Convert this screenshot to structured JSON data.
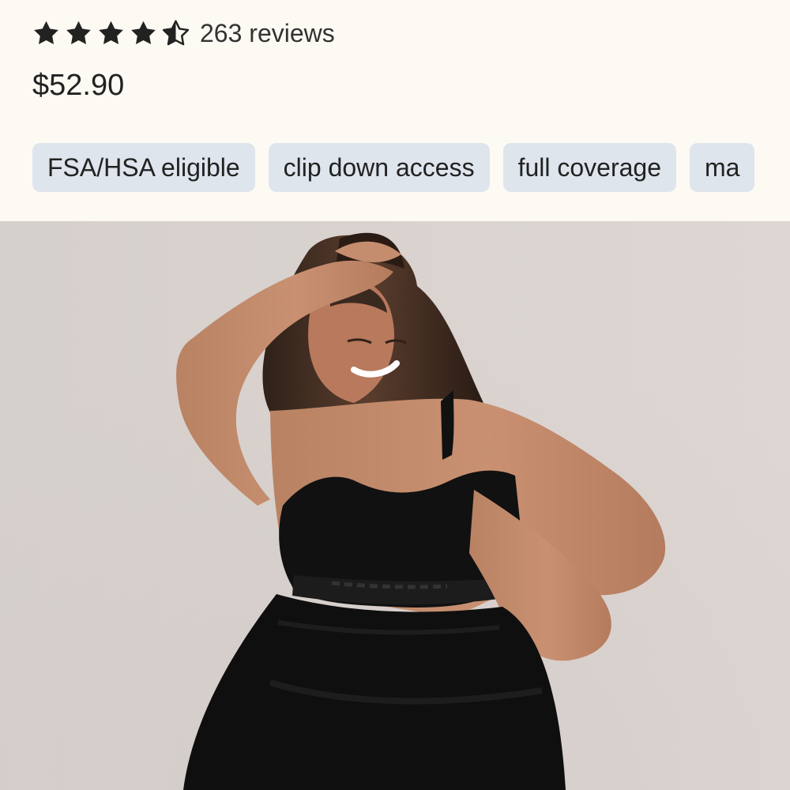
{
  "product": {
    "rating": 4.5,
    "rating_max": 5,
    "review_count_text": "263 reviews",
    "price": "$52.90",
    "tags": [
      "FSA/HSA eligible",
      "clip down access",
      "full coverage",
      "ma"
    ]
  },
  "image": {
    "subject": "product-photo"
  },
  "colors": {
    "background": "#fcfaf3",
    "chip_background": "#dfe5ec",
    "text": "#222222",
    "star": "#222222"
  },
  "icons": {
    "full_star": "star-icon",
    "half_star": "half-star-icon"
  }
}
